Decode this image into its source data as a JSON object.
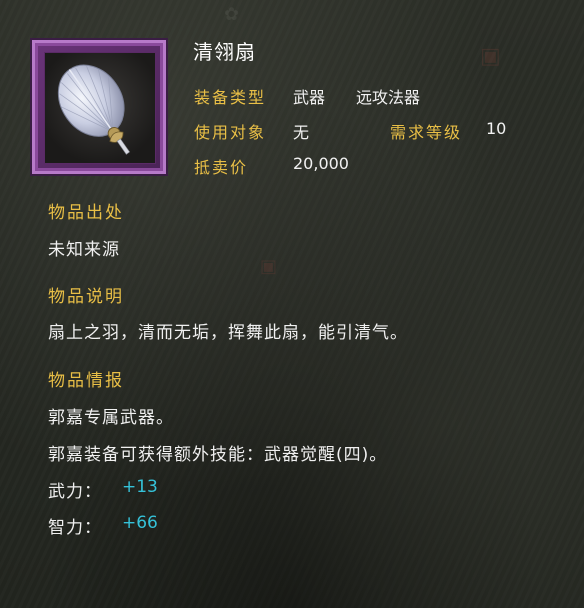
{
  "item": {
    "name": "清翎扇",
    "equip_type_label": "装备类型",
    "equip_type": "武器",
    "equip_subtype": "远攻法器",
    "target_label": "使用对象",
    "target": "无",
    "level_label": "需求等级",
    "level": "10",
    "price_label": "抵卖价",
    "price": "20,000",
    "rarity_color": "#b77ac9",
    "icon": "feather-fan-icon"
  },
  "sections": {
    "origin": {
      "title": "物品出处",
      "text": "未知来源"
    },
    "description": {
      "title": "物品说明",
      "text": "扇上之羽，清而无垢，挥舞此扇，能引清气。"
    },
    "intel": {
      "title": "物品情报",
      "line1": "郭嘉专属武器。",
      "line2": "郭嘉装备可获得额外技能：武器觉醒(四)。"
    }
  },
  "stats": [
    {
      "label": "武力：",
      "value": "+13"
    },
    {
      "label": "智力：",
      "value": "+66"
    }
  ],
  "colors": {
    "label_gold": "#e9bf46",
    "stat_cyan": "#35c2d9",
    "title_white": "#ffffff"
  }
}
